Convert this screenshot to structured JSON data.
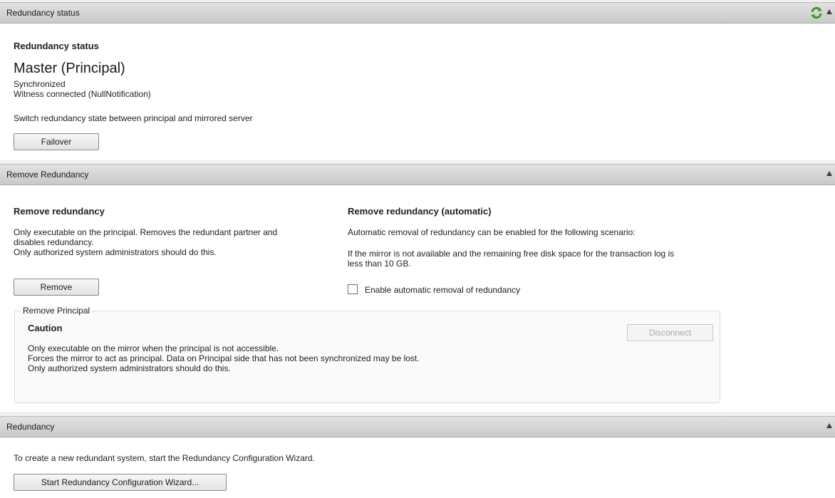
{
  "status_section": {
    "header": "Redundancy status",
    "title": "Redundancy status",
    "state": "Master (Principal)",
    "sync": "Synchronized",
    "witness": "Witness connected (NullNotification)",
    "switch_text": "Switch redundancy state between principal and mirrored server",
    "failover_label": "Failover"
  },
  "remove_section": {
    "header": "Remove Redundancy",
    "left": {
      "title": "Remove redundancy",
      "line1": "Only executable on the principal. Removes the redundant partner and",
      "line2": "disables redundancy.",
      "line3": "Only authorized system administrators should do this.",
      "remove_label": "Remove"
    },
    "right": {
      "title": "Remove redundancy (automatic)",
      "line1": "Automatic removal of redundancy can be enabled for the following scenario:",
      "line2": "If the mirror is not available and the remaining free disk space for the transaction log is",
      "line3": "less than 10 GB.",
      "checkbox_label": "Enable automatic removal of redundancy",
      "checkbox_checked": false
    },
    "principal_group": {
      "label": "Remove Principal",
      "caution": "Caution",
      "line1": "Only executable on the mirror when the principal is not accessible.",
      "line2": "Forces the mirror to act as principal. Data on Principal side that has not been synchronized may be lost.",
      "line3": "Only authorized system administrators should do this.",
      "disconnect_label": "Disconnect"
    }
  },
  "redundancy_section": {
    "header": "Redundancy",
    "text": "To create a new redundant system, start the Redundancy Configuration Wizard.",
    "wizard_label": "Start Redundancy Configuration Wizard..."
  },
  "colors": {
    "refresh_icon": "#3d9a2a"
  }
}
